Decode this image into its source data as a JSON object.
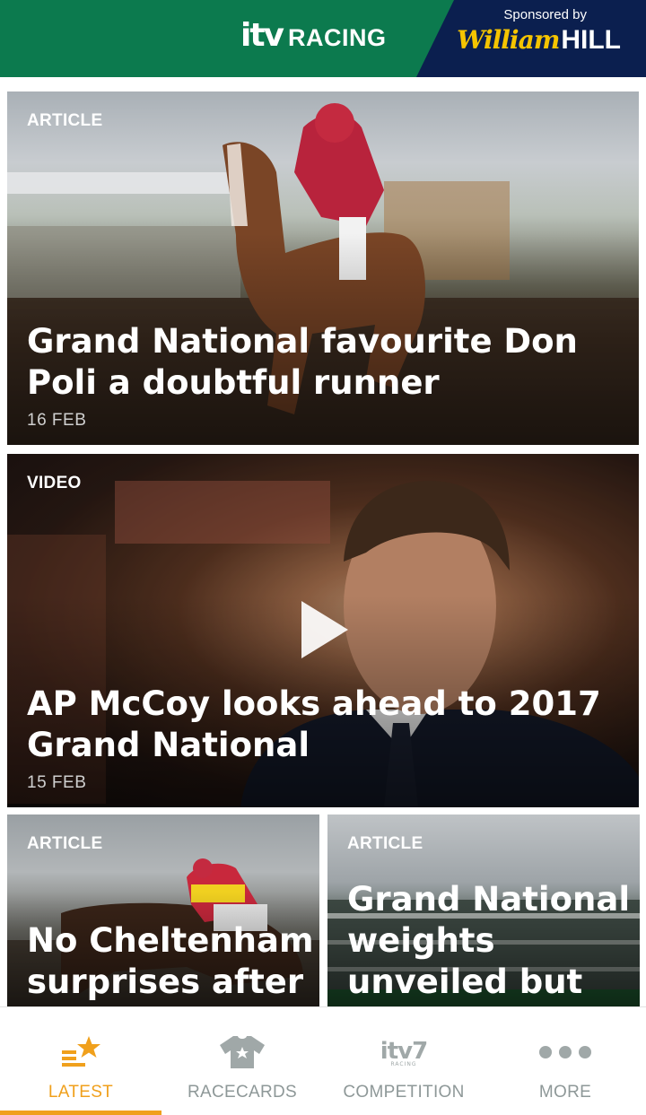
{
  "header": {
    "logo_itv": "itv",
    "logo_racing": "RACING",
    "sponsored_by": "Sponsored by",
    "sponsor_brand_1": "William",
    "sponsor_brand_2": "HILL",
    "colors": {
      "green": "#0c7a4e",
      "navy": "#0b1f4f",
      "gold": "#f5c400"
    }
  },
  "feed": {
    "cards": [
      {
        "type": "ARTICLE",
        "title": "Grand National favourite Don Poli a doubtful runner",
        "date": "16 FEB"
      },
      {
        "type": "VIDEO",
        "title": "AP McCoy looks ahead to 2017 Grand National",
        "date": "15 FEB",
        "icon": "play-icon"
      },
      {
        "type": "ARTICLE",
        "title": "No Cheltenham surprises after"
      },
      {
        "type": "ARTICLE",
        "title": "Grand National weights unveiled but"
      }
    ]
  },
  "bottom_nav": {
    "active_color": "#f0a01c",
    "items": [
      {
        "label": "LATEST",
        "icon": "latest-star-icon",
        "active": true
      },
      {
        "label": "RACECARDS",
        "icon": "jockey-silk-icon",
        "active": false
      },
      {
        "label": "COMPETITION",
        "icon": "itv7-icon",
        "active": false
      },
      {
        "label": "MORE",
        "icon": "more-dots-icon",
        "active": false
      }
    ],
    "itv7_main": "itv7",
    "itv7_sub": "RACING"
  }
}
